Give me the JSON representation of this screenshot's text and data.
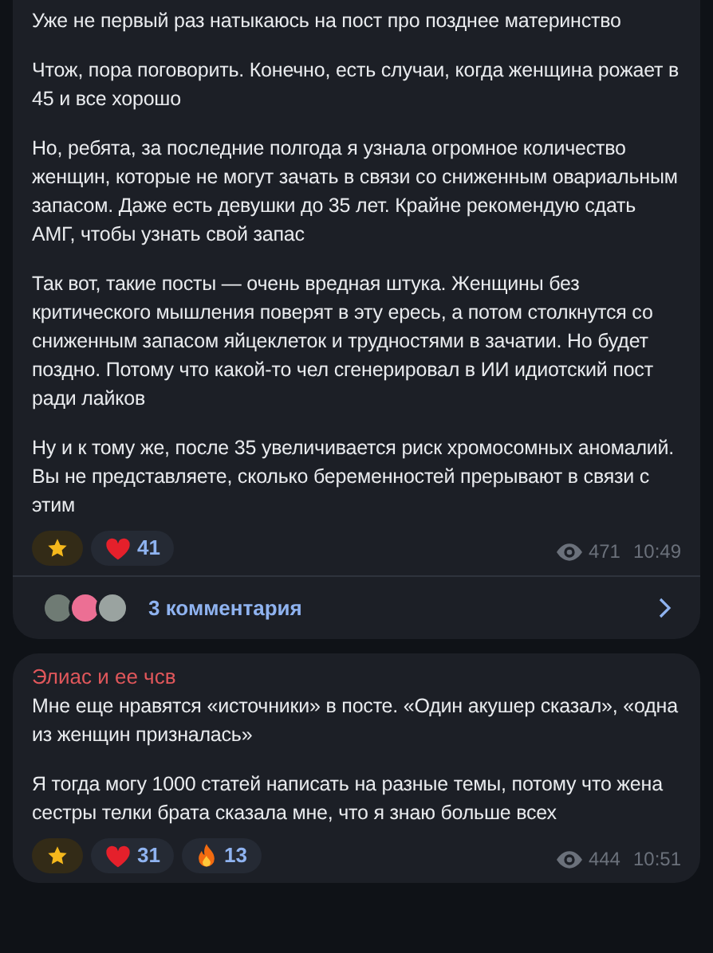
{
  "posts": [
    {
      "paragraphs": [
        "Уже не первый раз натыкаюсь на пост про позднее материнство",
        "Чтож, пора поговорить. Конечно, есть случаи, когда женщина рожает в 45 и все хорошо",
        "Но, ребята, за последние полгода я узнала огромное количество женщин, которые не могут зачать в связи со сниженным овариальным запасом. Даже  есть девушки до 35 лет. Крайне рекомендую сдать АМГ, чтобы узнать свой запас",
        "Так вот, такие посты — очень вредная штука. Женщины без критического мышления поверят в эту ересь, а потом столкнутся со сниженным запасом яйцеклеток и трудностями в зачатии. Но будет поздно. Потому что какой-то чел сгенерировал в ИИ идиотский пост ради лайков",
        "Ну и к тому же, после 35 увеличивается риск хромосомных аномалий. Вы не представляете, сколько беременностей прерывают в связи с этим"
      ],
      "reactions": [
        {
          "kind": "star"
        },
        {
          "kind": "heart",
          "count": "41"
        }
      ],
      "views": "471",
      "time": "10:49",
      "comments": {
        "label": "3 комментария"
      }
    },
    {
      "author": "Элиас и ее чсв",
      "color": "#e0575b",
      "paragraphs": [
        "Мне еще нравятся «источники» в посте. «Один акушер сказал», «одна из женщин призналась»",
        "Я тогда могу 1000 статей написать на разные темы, потому что жена сестры телки брата сказала мне, что я знаю больше всех"
      ],
      "reactions": [
        {
          "kind": "star"
        },
        {
          "kind": "heart",
          "count": "31"
        },
        {
          "kind": "fire",
          "count": "13"
        }
      ],
      "views": "444",
      "time": "10:51"
    }
  ]
}
